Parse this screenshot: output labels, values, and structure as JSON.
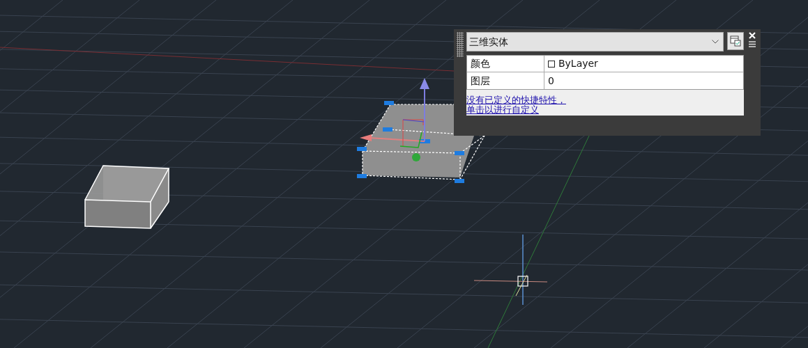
{
  "quick_properties": {
    "object_type": "三维实体",
    "properties": [
      {
        "kind": "color",
        "name": "颜色",
        "value": "ByLayer"
      },
      {
        "kind": "text",
        "name": "图层",
        "value": "0"
      }
    ],
    "customize_link": [
      "没有已定义的快捷特性，",
      "单击以进行自定义"
    ]
  }
}
